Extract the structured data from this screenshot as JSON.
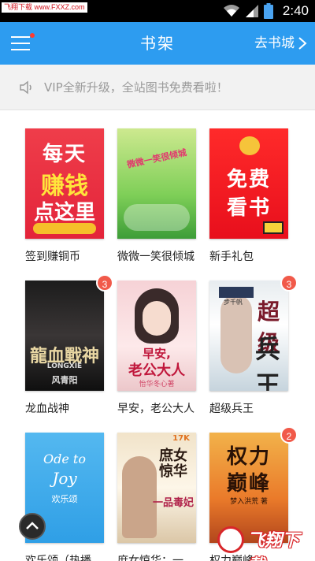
{
  "status_bar": {
    "watermark": "飞翔下载 www.FXXZ.com",
    "time": "2:40"
  },
  "app_bar": {
    "title": "书架",
    "store_link": "去书城"
  },
  "notice": {
    "text": "VIP全新升级，全站图书免费看啦！"
  },
  "books": [
    {
      "title": "签到赚铜币",
      "cover_text": [
        "每天",
        "赚钱",
        "点这里"
      ],
      "badge": ""
    },
    {
      "title": "微微一笑很倾城",
      "cover_text": [
        "微微一笑很倾城"
      ],
      "badge": ""
    },
    {
      "title": "新手礼包",
      "cover_text": [
        "免费",
        "看书"
      ],
      "badge": ""
    },
    {
      "title": "龙血战神",
      "cover_text": [
        "龍血戰神",
        "LONGXIE",
        "风青阳"
      ],
      "badge": "3"
    },
    {
      "title": "早安，老公大人",
      "cover_text": [
        "早安,",
        "老公大人",
        "怡华冬心著"
      ],
      "badge": ""
    },
    {
      "title": "超级兵王",
      "cover_text": [
        "超级",
        "兵王",
        "步千帆"
      ],
      "badge": "3"
    },
    {
      "title": "欢乐颂（热播...",
      "cover_text": [
        "Ode to",
        "Joy",
        "欢乐颂"
      ],
      "badge": ""
    },
    {
      "title": "庶女惊华：一...",
      "cover_text": [
        "庶女惊华",
        "一品毒妃",
        "17K"
      ],
      "badge": ""
    },
    {
      "title": "权力巅峰",
      "cover_text": [
        "权力",
        "巅峰",
        "梦入洪荒 著"
      ],
      "badge": "2"
    }
  ],
  "watermark": {
    "brand": "飞翔下载",
    "url": "www.fxxz.com"
  },
  "colors": {
    "app_bar": "#2d9cf0",
    "badge": "#f15a4a"
  }
}
